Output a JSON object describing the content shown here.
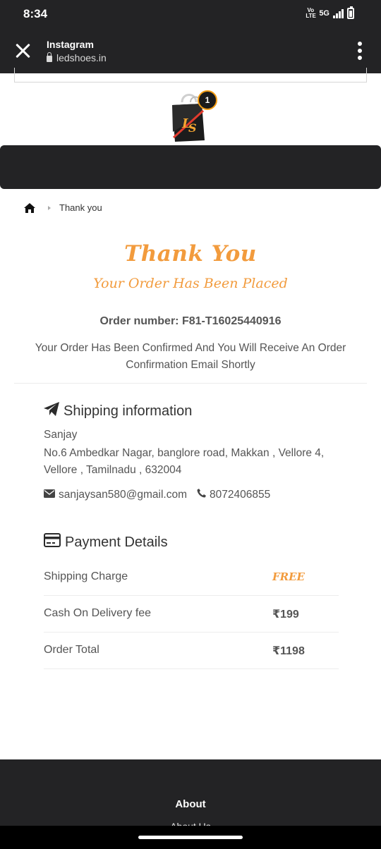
{
  "status_bar": {
    "time": "8:34",
    "network": "5G",
    "volte": "Vo LTE"
  },
  "browser": {
    "title": "Instagram",
    "url": "ledshoes.in"
  },
  "header": {
    "cart_count": "1",
    "logo_text": "LS"
  },
  "breadcrumb": {
    "current": "Thank you"
  },
  "thank_you": {
    "title": "Thank You",
    "subtitle": "Your Order Has Been Placed",
    "order_number": "Order number: F81-T16025440916",
    "confirmation": "Your Order Has Been Confirmed And You Will Receive An Order Confirmation Email Shortly"
  },
  "shipping": {
    "heading": "Shipping information",
    "name": "Sanjay",
    "address": "No.6 Ambedkar Nagar, banglore road, Makkan , Vellore 4, Vellore , Tamilnadu , 632004",
    "email": "sanjaysan580@gmail.com",
    "phone": "8072406855"
  },
  "payment": {
    "heading": "Payment Details",
    "rows": [
      {
        "label": "Shipping Charge",
        "value": "FREE"
      },
      {
        "label": "Cash On Delivery fee",
        "value": "₹199"
      },
      {
        "label": "Order Total",
        "value": "₹1198"
      }
    ]
  },
  "footer": {
    "about": "About",
    "about_us": "About Us"
  },
  "colors": {
    "accent": "#f29b3d",
    "dark_bar": "#232325",
    "text": "#555555"
  }
}
